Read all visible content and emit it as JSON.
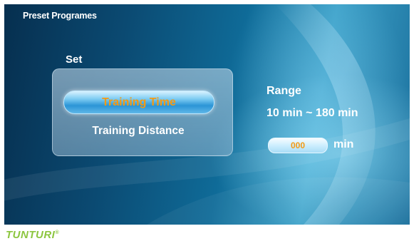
{
  "header": {
    "title": "Preset Programes"
  },
  "set": {
    "label": "Set",
    "options": [
      {
        "label": "Training Time",
        "selected": true
      },
      {
        "label": "Training Distance",
        "selected": false
      }
    ]
  },
  "range": {
    "label": "Range",
    "value": "10 min ~ 180 min",
    "input_value": "000",
    "unit": "min"
  },
  "brand": {
    "name": "TUNTURI",
    "mark": "®"
  },
  "colors": {
    "selected_text": "#f39a14",
    "logo": "#8cc63f",
    "background_dark": "#062f4f",
    "background_light": "#3ea2c9"
  }
}
